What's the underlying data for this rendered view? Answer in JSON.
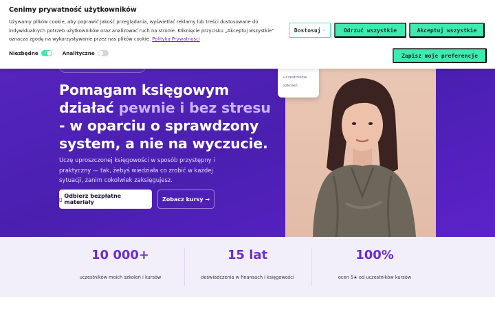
{
  "cookie": {
    "title": "Cenimy prywatność użytkowników",
    "text": "Używamy plików cookie, aby poprawić jakość przeglądania, wyświetlać reklamy lub treści dostosowane do indywidualnych potrzeb użytkowników oraz analizować ruch na stronie. Kliknięcie przycisku „Akceptuj wszystkie” oznacza zgodę na wykorzystywanie przez nas plików cookie.",
    "policy_link": "Polityka Prywatności",
    "customize_label": "Dostosuj",
    "reject_label": "Odrzuć wszystkie",
    "accept_label": "Akceptuj wszystkie",
    "save_label": "Zapisz moje preferencje",
    "toggles": [
      {
        "label": "Niezbędne",
        "on": true
      },
      {
        "label": "Analityczne",
        "on": false
      }
    ]
  },
  "hero": {
    "title_part1": "Pomagam księgowym działać ",
    "title_accent": "pewnie i bez stresu",
    "title_part2": " - w oparciu o sprawdzony system, a nie na wyczucie.",
    "description": "Uczę uproszczonej księgowości w sposób przystępny i praktyczny — tak, żebyś wiedziała co zrobić w każdej sytuacji, zanim cokolwiek zaksięgujesz.",
    "primary_cta": "Odbierz bezpłatne materiały",
    "primary_cta_icon": "▯",
    "secondary_cta": "Zobacz kursy →",
    "float_card": {
      "line1": "uczestników",
      "line2": "szkoleń"
    }
  },
  "stats": [
    {
      "value": "10 000+",
      "label": "uczestników moich szkoleń i kursów"
    },
    {
      "value": "15 lat",
      "label": "doświadczenia w finansach i księgowości"
    },
    {
      "value": "100%",
      "label": "ocen 5★ od uczestników kursów"
    }
  ],
  "colors": {
    "hero_bg": "#5a26c4",
    "accent_text": "#c9b3ff",
    "stat_value": "#6b2cd6",
    "cookie_button": "#3eeab0"
  }
}
